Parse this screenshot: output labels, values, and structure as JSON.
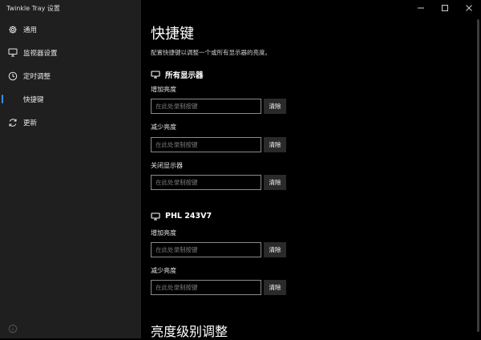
{
  "window": {
    "title": "Twinkle Tray 设置"
  },
  "sidebar": {
    "items": [
      {
        "label": "通用",
        "icon": "gear-icon",
        "active": false
      },
      {
        "label": "监视器设置",
        "icon": "monitor-icon",
        "active": false
      },
      {
        "label": "定时调整",
        "icon": "clock-icon",
        "active": false
      },
      {
        "label": "快捷键",
        "icon": "shortcut-icon",
        "active": true
      },
      {
        "label": "更新",
        "icon": "refresh-icon",
        "active": false
      }
    ],
    "bottom_icon": "info-icon"
  },
  "main": {
    "title": "快捷键",
    "description": "配置快捷键以调整一个或所有显示器的亮度。",
    "groups": [
      {
        "name": "所有显示器",
        "icon": "monitor-icon",
        "fields": [
          {
            "label": "增加亮度",
            "placeholder": "在此处录制按键",
            "clear_label": "清除"
          },
          {
            "label": "减少亮度",
            "placeholder": "在此处录制按键",
            "clear_label": "清除"
          },
          {
            "label": "关闭显示器",
            "placeholder": "在此处录制按键",
            "clear_label": "清除"
          }
        ]
      },
      {
        "name": "PHL 243V7",
        "icon": "monitor-icon",
        "fields": [
          {
            "label": "增加亮度",
            "placeholder": "在此处录制按键",
            "clear_label": "清除"
          },
          {
            "label": "减少亮度",
            "placeholder": "在此处录制按键",
            "clear_label": "清除"
          }
        ]
      }
    ],
    "next_section_title": "亮度级别调整"
  },
  "colors": {
    "sidebar_bg": "#1f1f1f",
    "main_bg": "#000000",
    "accent": "#3b8fe6",
    "button_bg": "#2a2a2a",
    "input_border": "#8a8a8a"
  }
}
